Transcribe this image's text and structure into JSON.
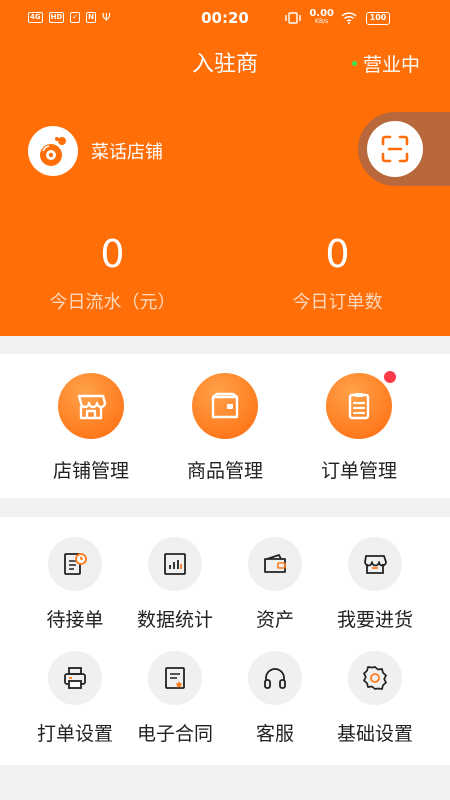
{
  "status_bar": {
    "time": "00:20",
    "network_speed": "0.00",
    "speed_unit": "KB/s",
    "battery": "100",
    "left_badges": [
      "4G",
      "HD",
      "✓",
      "N",
      "Ψ"
    ]
  },
  "header": {
    "title": "入驻商",
    "business_status": "营业中",
    "accent_color": "#ff6e07"
  },
  "store": {
    "name": "菜话店铺"
  },
  "stats": [
    {
      "value": "0",
      "label": "今日流水（元）"
    },
    {
      "value": "0",
      "label": "今日订单数"
    }
  ],
  "quick_actions": [
    {
      "label": "店铺管理",
      "icon": "store-icon"
    },
    {
      "label": "商品管理",
      "icon": "box-icon"
    },
    {
      "label": "订单管理",
      "icon": "clipboard-icon",
      "has_badge": true
    }
  ],
  "tools": [
    {
      "label": "待接单",
      "icon": "pending-order-icon"
    },
    {
      "label": "数据统计",
      "icon": "chart-icon"
    },
    {
      "label": "资产",
      "icon": "wallet-icon"
    },
    {
      "label": "我要进货",
      "icon": "shop-icon"
    },
    {
      "label": "打单设置",
      "icon": "printer-icon"
    },
    {
      "label": "电子合同",
      "icon": "contract-icon"
    },
    {
      "label": "客服",
      "icon": "headset-icon"
    },
    {
      "label": "基础设置",
      "icon": "settings-icon"
    }
  ]
}
